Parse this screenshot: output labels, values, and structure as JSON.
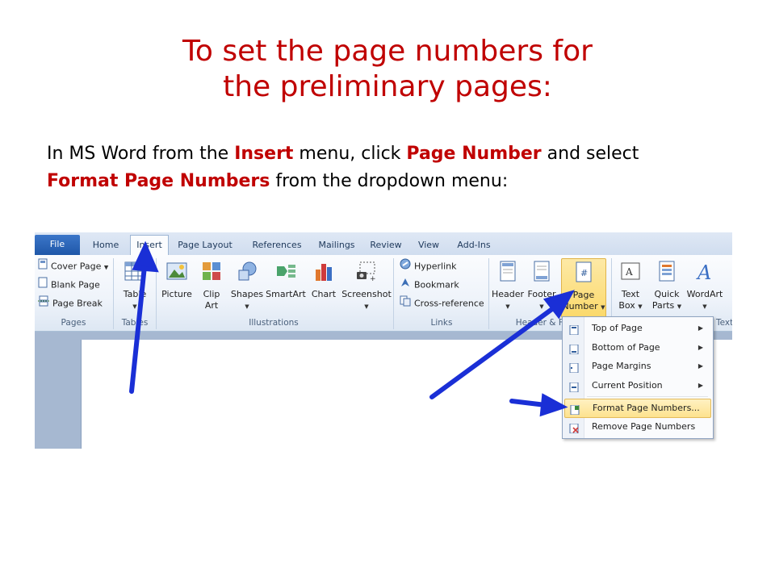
{
  "title": {
    "line1": "To set the page numbers for",
    "line2": "the preliminary pages:"
  },
  "instruction": {
    "part1": "In MS Word from the ",
    "insert": "Insert",
    "part2": " menu, click ",
    "page_number": "Page Number",
    "part3": " and select ",
    "format": "Format Page Numbers",
    "part4": " from the dropdown menu:"
  },
  "ribbon": {
    "tabs": [
      "File",
      "Home",
      "Insert",
      "Page Layout",
      "References",
      "Mailings",
      "Review",
      "View",
      "Add-Ins"
    ],
    "active_tab": "Insert",
    "pages_group": {
      "label": "Pages",
      "items": [
        "Cover Page",
        "Blank Page",
        "Page Break"
      ]
    },
    "tables_group": {
      "label": "Tables",
      "button": "Table"
    },
    "illustrations_group": {
      "label": "Illustrations",
      "buttons": [
        {
          "line1": "Picture",
          "line2": ""
        },
        {
          "line1": "Clip",
          "line2": "Art"
        },
        {
          "line1": "Shapes",
          "line2": ""
        },
        {
          "line1": "SmartArt",
          "line2": ""
        },
        {
          "line1": "Chart",
          "line2": ""
        },
        {
          "line1": "Screenshot",
          "line2": ""
        }
      ]
    },
    "links_group": {
      "label": "Links",
      "items": [
        "Hyperlink",
        "Bookmark",
        "Cross-reference"
      ]
    },
    "header_footer_group": {
      "label": "Header & Footer",
      "buttons": [
        {
          "line1": "Header",
          "line2": ""
        },
        {
          "line1": "Footer",
          "line2": ""
        },
        {
          "line1": "Page",
          "line2": "Number"
        }
      ]
    },
    "text_group": {
      "label": "Text",
      "buttons": [
        {
          "line1": "Text",
          "line2": "Box"
        },
        {
          "line1": "Quick",
          "line2": "Parts"
        },
        {
          "line1": "WordArt",
          "line2": ""
        }
      ]
    }
  },
  "dropdown": {
    "items": [
      {
        "label": "Top of Page",
        "submenu": true
      },
      {
        "label": "Bottom of Page",
        "submenu": true
      },
      {
        "label": "Page Margins",
        "submenu": true
      },
      {
        "label": "Current Position",
        "submenu": true
      },
      {
        "label": "Format Page Numbers...",
        "submenu": false,
        "highlighted": true
      },
      {
        "label": "Remove Page Numbers",
        "submenu": false
      }
    ]
  },
  "colors": {
    "title_red": "#c00000",
    "arrow_blue": "#1a2fd6",
    "file_tab_blue": "#2a62b8",
    "highlight_gold": "#fbd96b"
  }
}
